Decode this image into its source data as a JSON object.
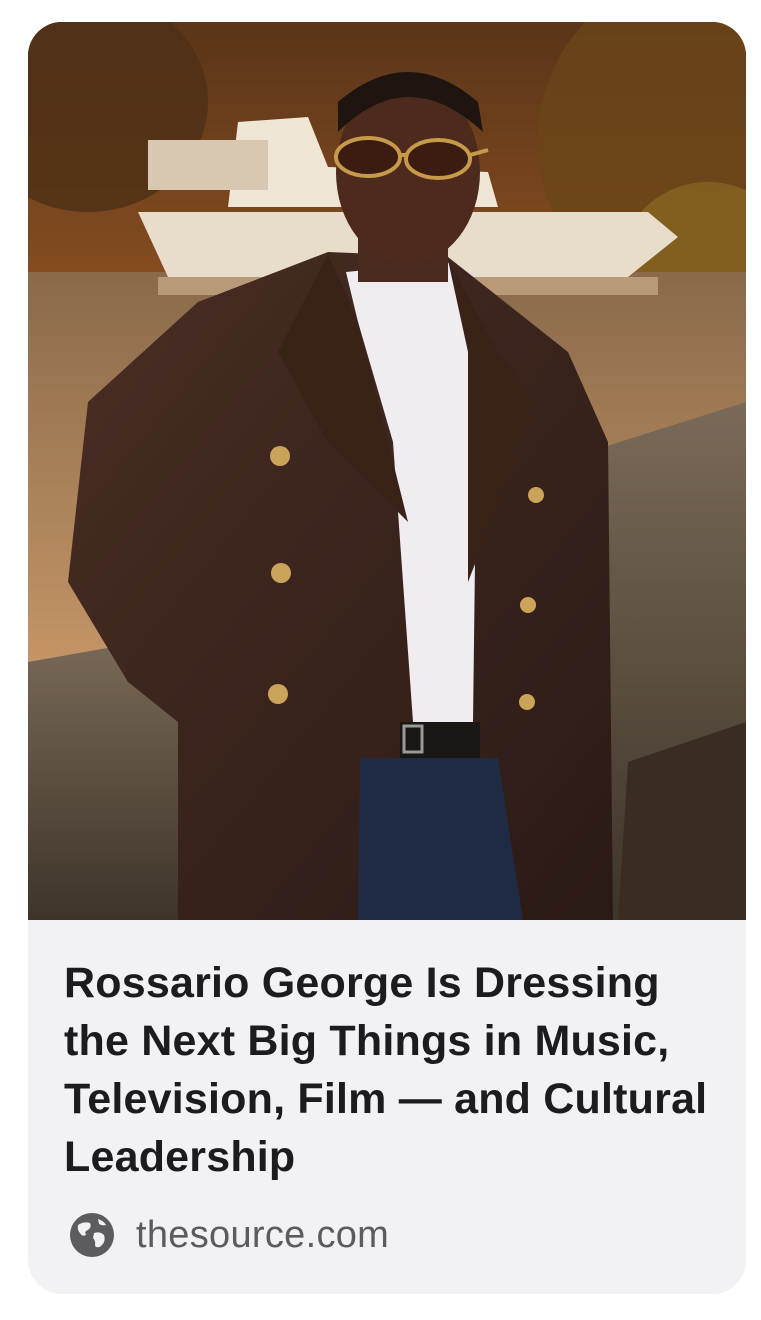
{
  "link_preview": {
    "image_alt": "Man in dark double-breasted coat, white turtleneck and sunglasses leaning on a stone wall by a lake with a yacht",
    "title": "Rossario George Is Dressing the Next Big Things in Music, Television, Film — and Cultural Leadership",
    "source_icon": "globe-icon",
    "source_domain": "thesource.com"
  },
  "colors": {
    "card_background": "#f2f2f4",
    "title_text": "#1c1c1e",
    "domain_text": "#5b5b60"
  }
}
